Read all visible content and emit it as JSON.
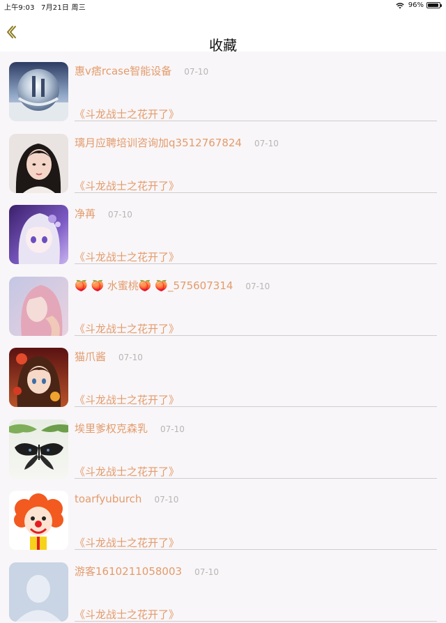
{
  "status_bar": {
    "time": "上午9:03",
    "date": "7月21日 周三",
    "battery": "96%",
    "battery_level": 0.96,
    "wifi_icon": "wifi-icon",
    "battery_icon": "battery-icon"
  },
  "header": {
    "title": "收藏",
    "back_icon": "chevron-left-icon",
    "accent_color": "#8a7a1f"
  },
  "colors": {
    "text_accent": "#e39b6c",
    "date_gray": "#b9b5b5",
    "background": "#f8f6f8"
  },
  "favorites": [
    {
      "username": "惠v痞rcase智能设备",
      "date": "07-10",
      "title": "《斗龙战士之花开了》",
      "avatar": "crystal-ball-avatar"
    },
    {
      "username": "璃月应聘培训咨询加q3512767824",
      "date": "07-10",
      "title": "《斗龙战士之花开了》",
      "avatar": "girl-photo-avatar"
    },
    {
      "username": "净苒",
      "date": "07-10",
      "title": "《斗龙战士之花开了》",
      "avatar": "anime-girl-purple-avatar"
    },
    {
      "username": "🍑 🍑 水蜜桃🍑 🍑_575607314",
      "date": "07-10",
      "title": "《斗龙战士之花开了》",
      "avatar": "pink-hair-girl-avatar"
    },
    {
      "username": "猫爪酱",
      "date": "07-10",
      "title": "《斗龙战士之花开了》",
      "avatar": "anime-girl-red-avatar"
    },
    {
      "username": "埃里爹权克森乳",
      "date": "07-10",
      "title": "《斗龙战士之花开了》",
      "avatar": "butterfly-avatar"
    },
    {
      "username": "toarfyuburch",
      "date": "07-10",
      "title": "《斗龙战士之花开了》",
      "avatar": "clown-avatar"
    },
    {
      "username": "游客1610211058003",
      "date": "07-10",
      "title": "《斗龙战士之花开了》",
      "avatar": "default-user-avatar"
    }
  ]
}
